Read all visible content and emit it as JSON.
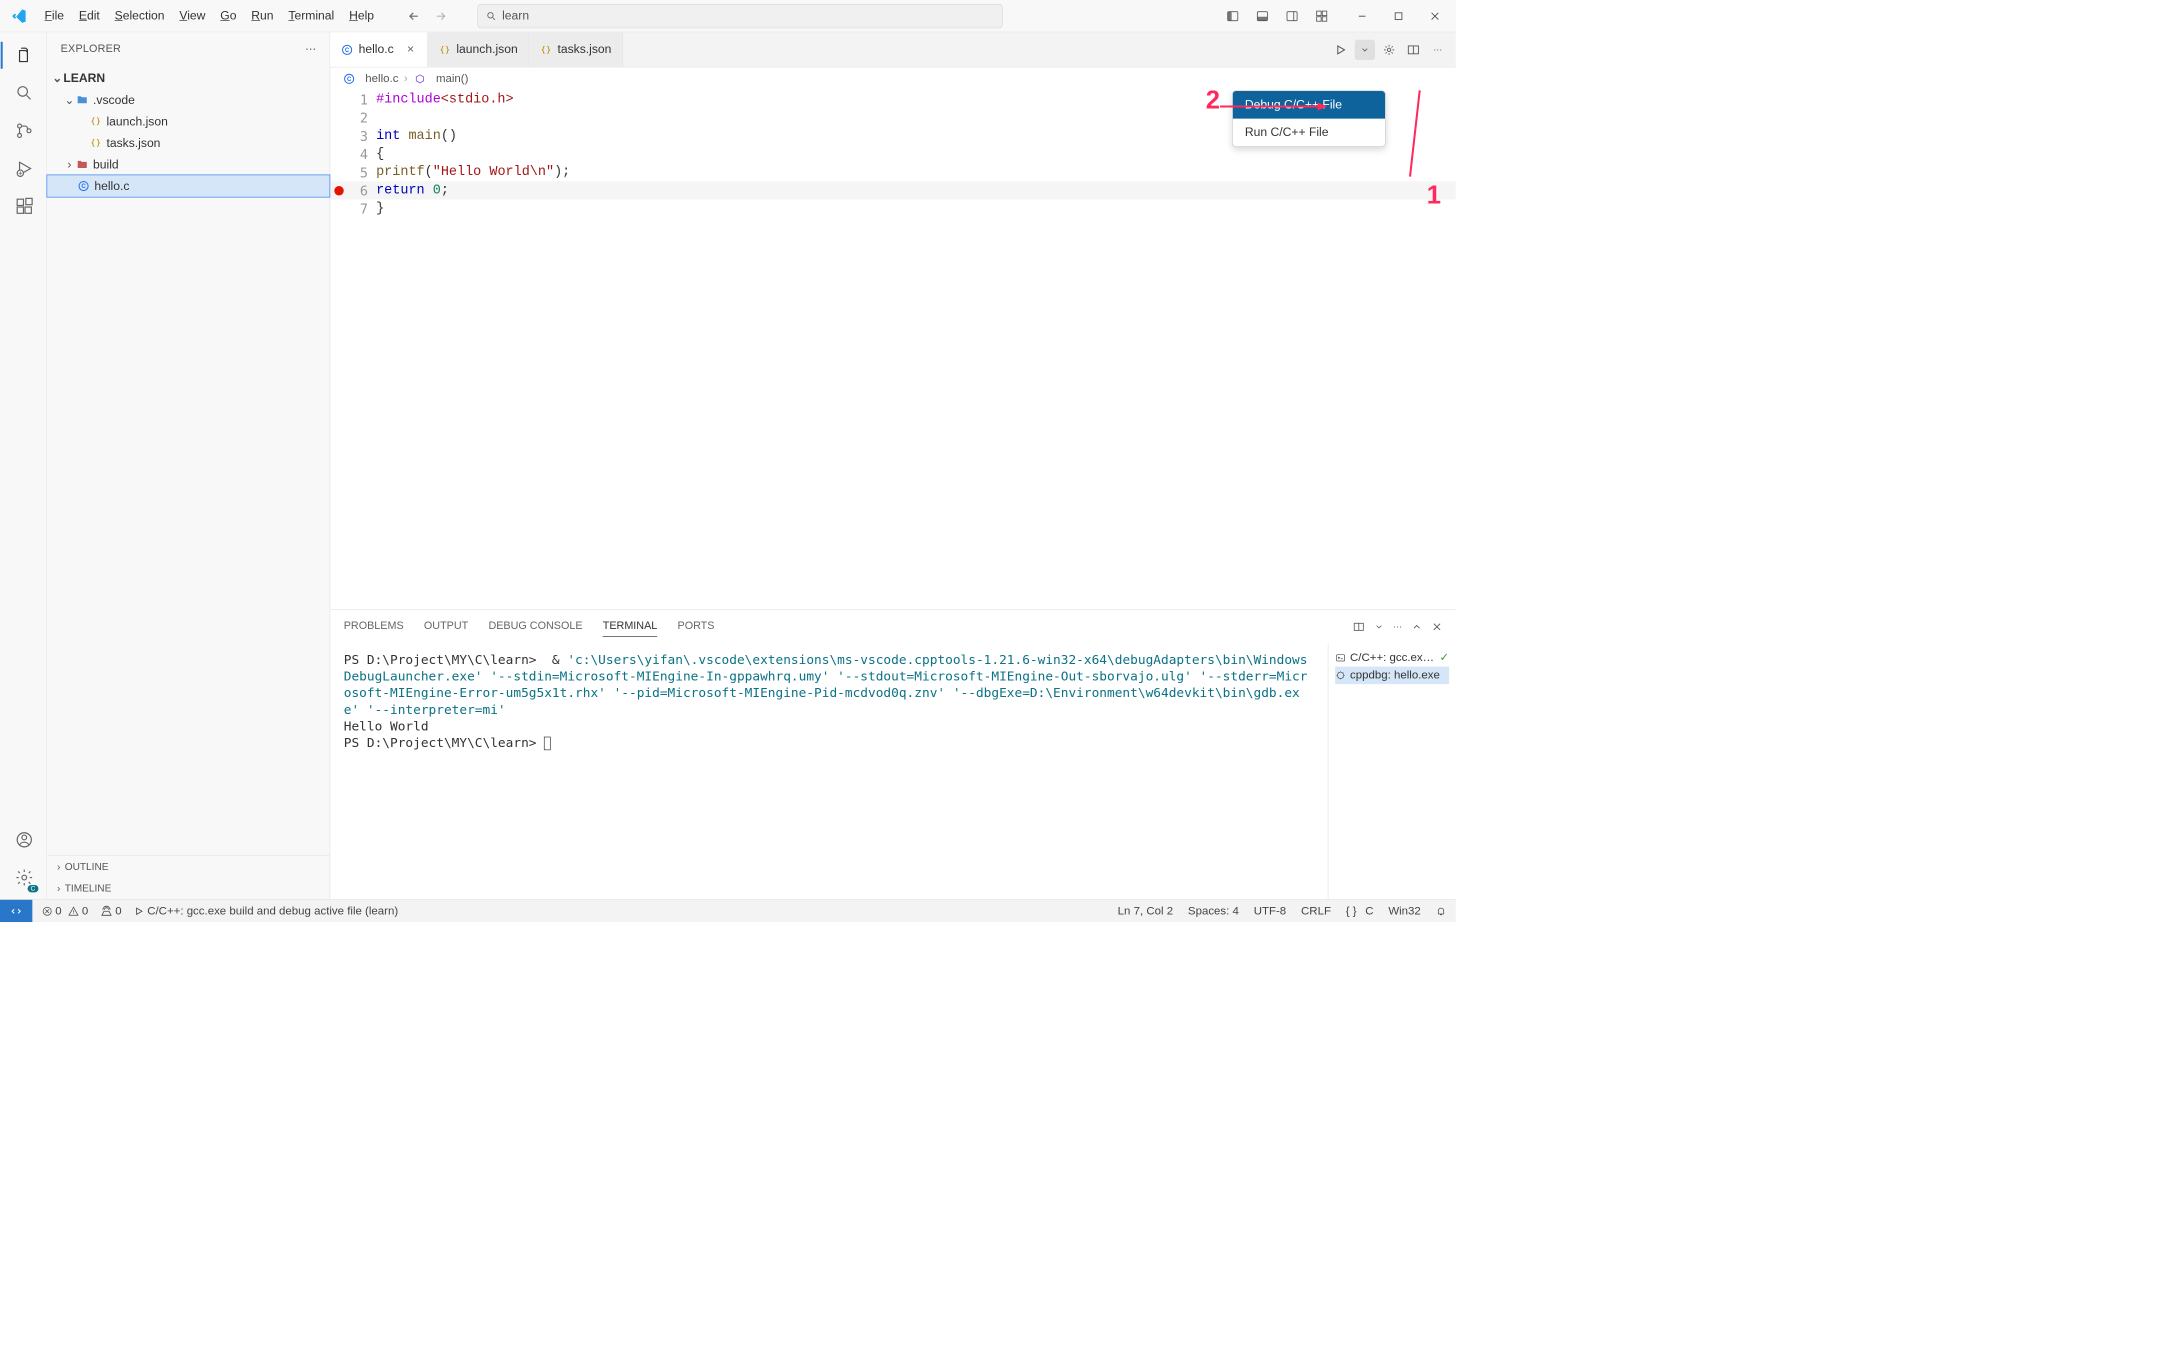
{
  "menu": [
    "File",
    "Edit",
    "Selection",
    "View",
    "Go",
    "Run",
    "Terminal",
    "Help"
  ],
  "menu_underline_idx": [
    0,
    0,
    0,
    0,
    0,
    0,
    0,
    0
  ],
  "search": {
    "text": "learn"
  },
  "sidebar": {
    "title": "EXPLORER",
    "root": "LEARN",
    "tree": {
      "vscode": {
        "label": ".vscode",
        "items": [
          "launch.json",
          "tasks.json"
        ]
      },
      "build": {
        "label": "build"
      },
      "file": {
        "label": "hello.c"
      }
    },
    "outline": "OUTLINE",
    "timeline": "TIMELINE"
  },
  "tabs": [
    {
      "label": "hello.c",
      "icon": "c",
      "active": true,
      "close": true
    },
    {
      "label": "launch.json",
      "icon": "json",
      "active": false,
      "close": false
    },
    {
      "label": "tasks.json",
      "icon": "json",
      "active": false,
      "close": false
    }
  ],
  "breadcrumbs": {
    "file": "hello.c",
    "symbol": "main()"
  },
  "code": {
    "lines": [
      {
        "n": 1,
        "html": "<span class='pre'>#include</span><span class='inc'>&lt;stdio.h&gt;</span>"
      },
      {
        "n": 2,
        "html": ""
      },
      {
        "n": 3,
        "html": "<span class='kw'>int</span> <span class='fn'>main</span><span class='pun'>()</span>"
      },
      {
        "n": 4,
        "html": "<span class='pun'>{</span>"
      },
      {
        "n": 5,
        "html": "    <span class='fn'>printf</span><span class='pun'>(</span><span class='str'>\"Hello World\\n\"</span><span class='pun'>);</span>"
      },
      {
        "n": 6,
        "html": "    <span class='kw'>return</span> <span class='num'>0</span><span class='pun'>;</span>",
        "bp": true,
        "current": true
      },
      {
        "n": 7,
        "html": "<span class='pun'>}</span>"
      }
    ]
  },
  "run_menu": {
    "items": [
      "Debug C/C++ File",
      "Run C/C++ File"
    ],
    "selected": 0
  },
  "annotations": {
    "a1": "1",
    "a2": "2"
  },
  "panel": {
    "tabs": [
      "PROBLEMS",
      "OUTPUT",
      "DEBUG CONSOLE",
      "TERMINAL",
      "PORTS"
    ],
    "active": 3,
    "terminal": {
      "prompt1": "PS D:\\Project\\MY\\C\\learn>  & ",
      "cmd": "'c:\\Users\\yifan\\.vscode\\extensions\\ms-vscode.cpptools-1.21.6-win32-x64\\debugAdapters\\bin\\WindowsDebugLauncher.exe' '--stdin=Microsoft-MIEngine-In-gppawhrq.umy' '--stdout=Microsoft-MIEngine-Out-sborvajo.ulg' '--stderr=Microsoft-MIEngine-Error-um5g5x1t.rhx' '--pid=Microsoft-MIEngine-Pid-mcdvod0q.znv' '--dbgExe=D:\\Environment\\w64devkit\\bin\\gdb.exe' '--interpreter=mi'",
      "out": "Hello World",
      "prompt2": "PS D:\\Project\\MY\\C\\learn> "
    },
    "sessions": [
      {
        "label": "C/C++: gcc.ex…",
        "icon": "term",
        "check": true
      },
      {
        "label": "cppdbg: hello.exe",
        "icon": "bug"
      }
    ]
  },
  "status": {
    "errors": "0",
    "warnings": "0",
    "ports": "0",
    "task": "C/C++: gcc.exe build and debug active file (learn)",
    "pos": "Ln 7, Col 2",
    "spaces": "Spaces: 4",
    "enc": "UTF-8",
    "eol": "CRLF",
    "lang_braces": "{ }",
    "lang": "C",
    "os": "Win32"
  }
}
